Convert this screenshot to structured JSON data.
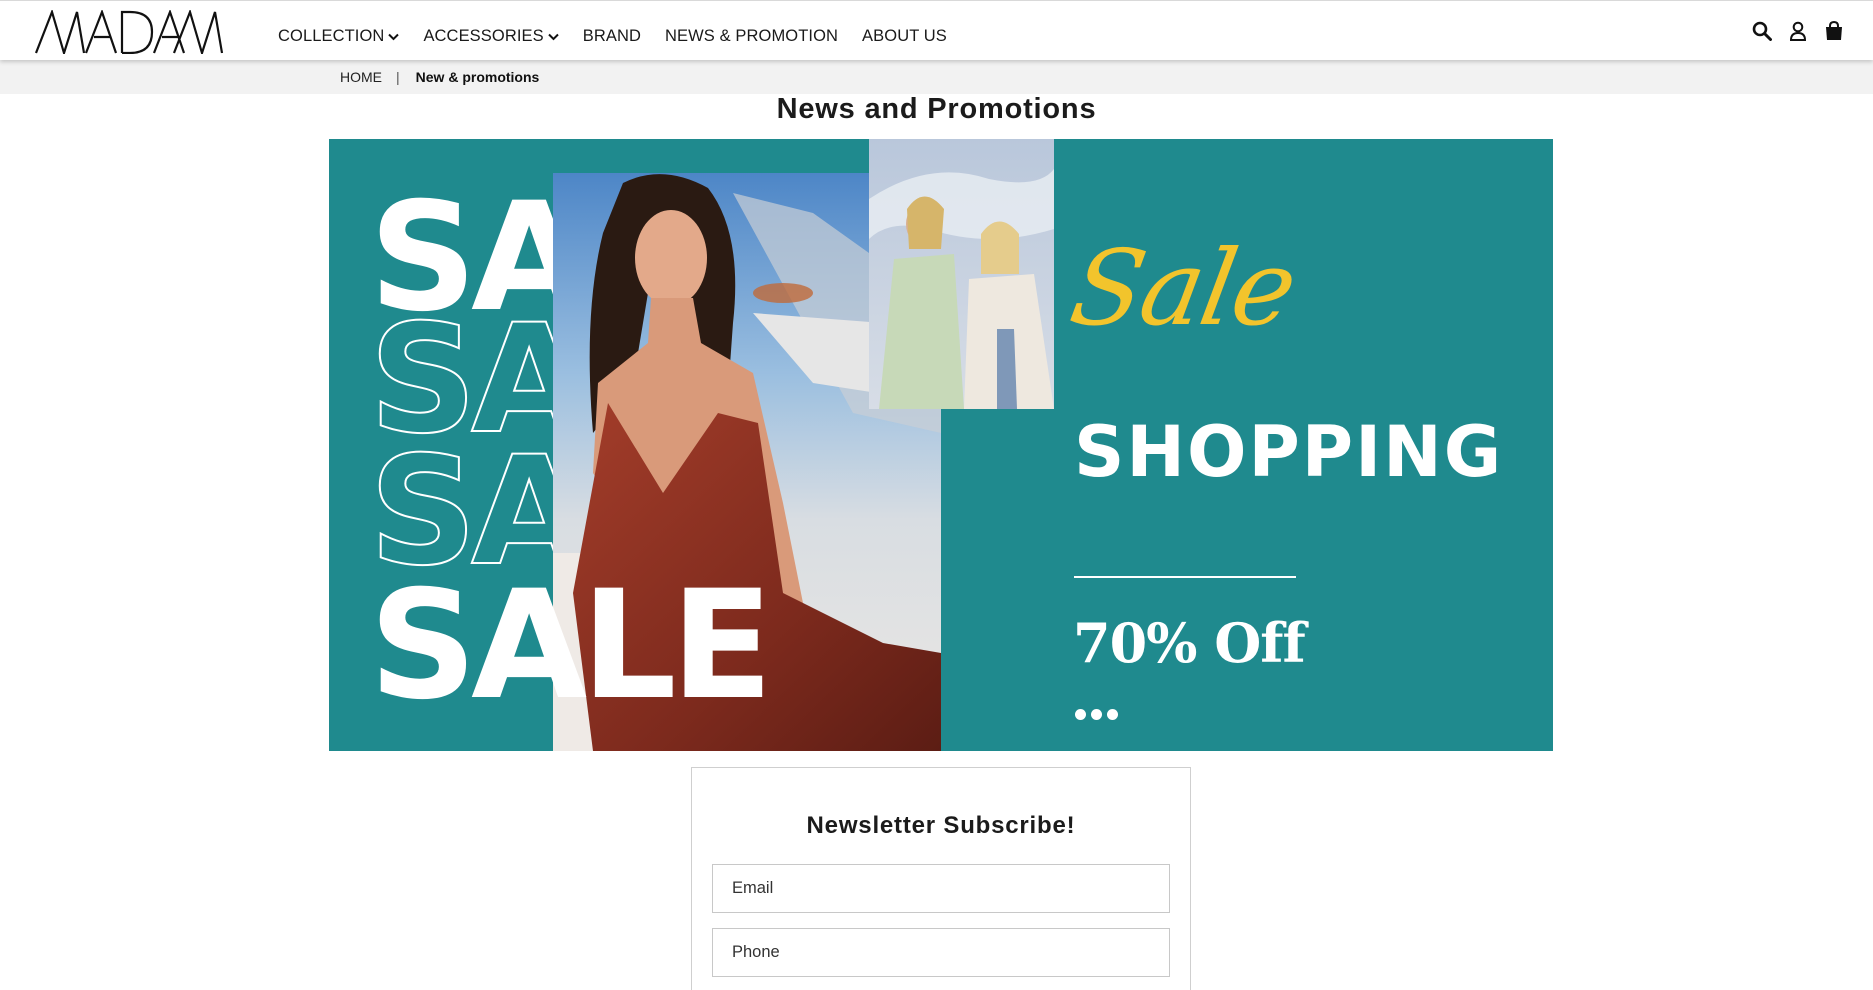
{
  "header": {
    "brand": "MADAM",
    "nav": [
      {
        "label": "COLLECTION",
        "has_dropdown": true
      },
      {
        "label": "ACCESSORIES",
        "has_dropdown": true
      },
      {
        "label": "BRAND",
        "has_dropdown": false
      },
      {
        "label": "NEWS & PROMOTION",
        "has_dropdown": false
      },
      {
        "label": "ABOUT US",
        "has_dropdown": false
      }
    ],
    "icons": [
      "search-icon",
      "user-icon",
      "shopping-bag-icon"
    ]
  },
  "breadcrumb": {
    "home": "HOME",
    "separator": "|",
    "current": "New & promotions"
  },
  "page": {
    "title": "News and Promotions"
  },
  "banner": {
    "background_color": "#1f8a8e",
    "sale_text": "SALE",
    "script_text": "Sale",
    "script_color": "#f2c42c",
    "headline": "SHOPPING",
    "discount": "70% Off"
  },
  "newsletter": {
    "title": "Newsletter Subscribe!",
    "email_placeholder": "Email",
    "phone_placeholder": "Phone"
  }
}
